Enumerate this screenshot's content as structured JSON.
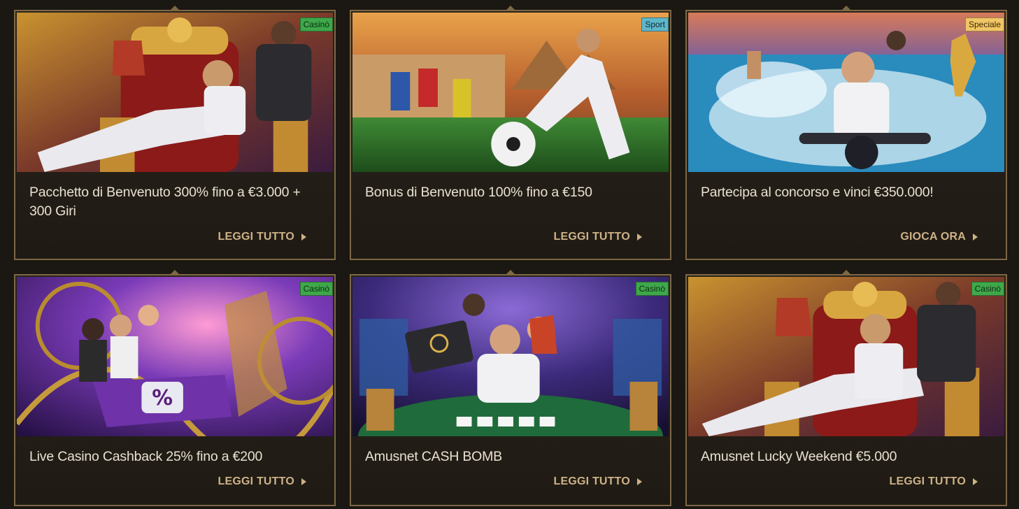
{
  "cards": [
    {
      "badge": "Casinò",
      "title": "Pacchetto di Benvenuto 300% fino a €3.000 + 300 Giri",
      "cta": "LEGGI TUTTO"
    },
    {
      "badge": "Sport",
      "title": "Bonus di Benvenuto 100% fino a €150",
      "cta": "LEGGI TUTTO"
    },
    {
      "badge": "Speciale",
      "title": "Partecipa al concorso e vinci €350.000!",
      "cta": "GIOCA ORA"
    },
    {
      "badge": "Casinò",
      "title": "Live Casino Cashback 25% fino a €200",
      "cta": "LEGGI TUTTO"
    },
    {
      "badge": "Casinò",
      "title": "Amusnet CASH BOMB",
      "cta": "LEGGI TUTTO"
    },
    {
      "badge": "Casinò",
      "title": "Amusnet Lucky Weekend €5.000",
      "cta": "LEGGI TUTTO"
    }
  ],
  "colors": {
    "background": "#1b1712",
    "border": "#7d6845",
    "cta": "#cdb288",
    "casino_badge": "#3ea84a",
    "sport_badge": "#5fb6c9",
    "speciale_badge": "#f1c666"
  }
}
